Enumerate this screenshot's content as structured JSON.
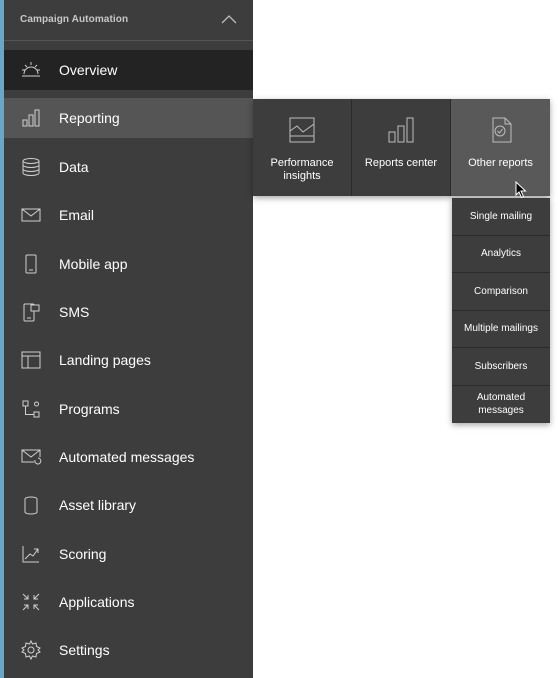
{
  "sidebar": {
    "title": "Campaign Automation",
    "items": [
      {
        "label": "Overview",
        "icon": "sunrise-icon",
        "state": "active"
      },
      {
        "label": "Reporting",
        "icon": "bar-chart-icon",
        "state": "hover"
      },
      {
        "label": "Data",
        "icon": "database-icon"
      },
      {
        "label": "Email",
        "icon": "envelope-icon"
      },
      {
        "label": "Mobile app",
        "icon": "mobile-phone-icon"
      },
      {
        "label": "SMS",
        "icon": "sms-phone-icon"
      },
      {
        "label": "Landing pages",
        "icon": "layout-icon"
      },
      {
        "label": "Programs",
        "icon": "program-flow-icon"
      },
      {
        "label": "Automated messages",
        "icon": "envelope-refresh-icon"
      },
      {
        "label": "Asset library",
        "icon": "cylinder-icon"
      },
      {
        "label": "Scoring",
        "icon": "trend-chart-icon"
      },
      {
        "label": "Applications",
        "icon": "collapse-arrows-icon"
      },
      {
        "label": "Settings",
        "icon": "gear-icon"
      }
    ]
  },
  "reporting_flyout": {
    "items": [
      {
        "label": "Performance insights",
        "icon": "line-chart-icon"
      },
      {
        "label": "Reports center",
        "icon": "bar-chart-icon"
      },
      {
        "label": "Other reports",
        "icon": "document-check-icon",
        "state": "selected"
      }
    ]
  },
  "other_reports_menu": {
    "items": [
      "Single mailing",
      "Analytics",
      "Comparison",
      "Multiple mailings",
      "Subscribers",
      "Automated messages"
    ]
  },
  "colors": {
    "sidebar_bg": "#3d3d3d",
    "active_bg": "#232323",
    "hover_bg": "#555555",
    "accent": "#6aa6c8"
  }
}
